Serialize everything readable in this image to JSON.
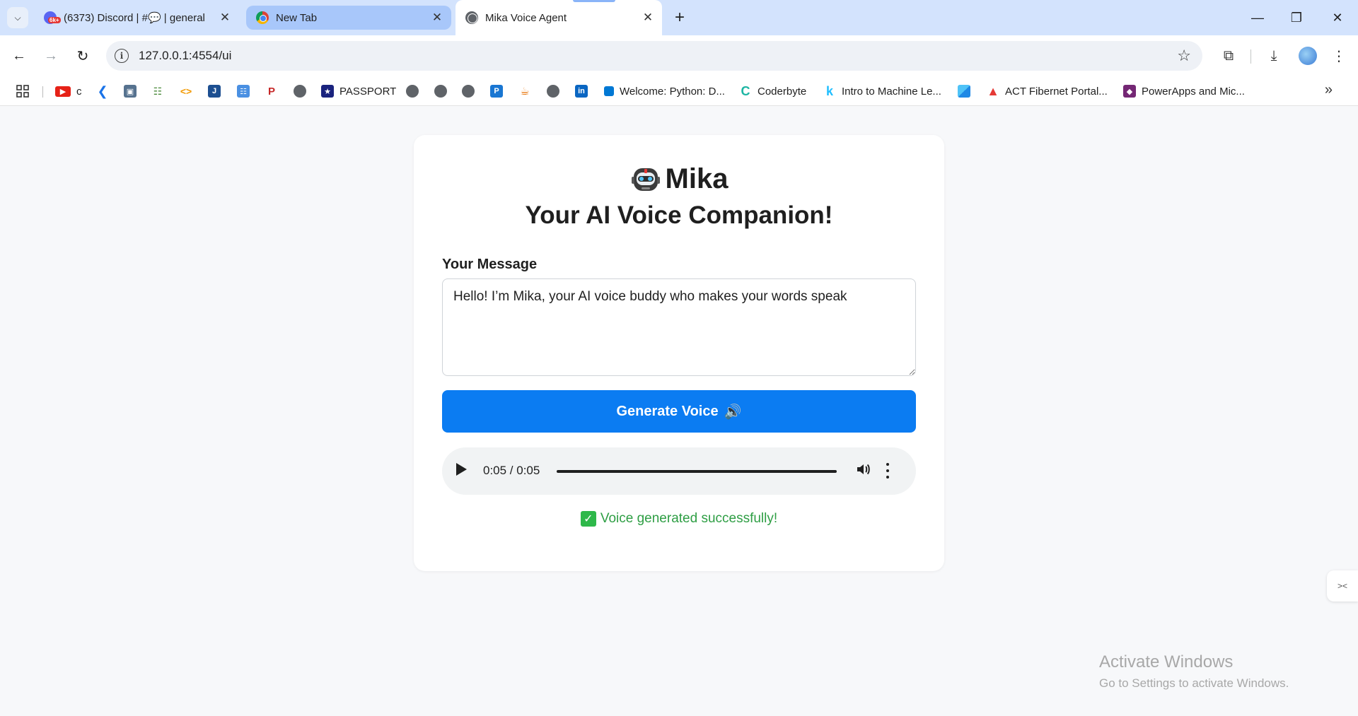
{
  "browser": {
    "tabs": [
      {
        "title": "(6373) Discord | #💬 | general",
        "favicon": "discord-icon",
        "badge": "6k+",
        "active": false
      },
      {
        "title": "New Tab",
        "favicon": "chrome-icon",
        "active": false
      },
      {
        "title": "Mika Voice Agent",
        "favicon": "globe-icon",
        "active": true
      }
    ],
    "url": "127.0.0.1:4554/ui",
    "bookmarks": [
      {
        "label": "c",
        "icon": "youtube-icon"
      },
      {
        "label": "",
        "icon": "kotak-icon"
      },
      {
        "label": "",
        "icon": "computer-icon"
      },
      {
        "label": "",
        "icon": "grid-icon"
      },
      {
        "label": "",
        "icon": "code-icon"
      },
      {
        "label": "",
        "icon": "j-icon"
      },
      {
        "label": "",
        "icon": "people-icon"
      },
      {
        "label": "",
        "icon": "graduate-icon"
      },
      {
        "label": "",
        "icon": "globe-icon"
      },
      {
        "label": "PASSPORT",
        "icon": "passport-icon"
      },
      {
        "label": "",
        "icon": "globe-icon"
      },
      {
        "label": "",
        "icon": "globe-icon"
      },
      {
        "label": "",
        "icon": "globe-icon"
      },
      {
        "label": "",
        "icon": "p-icon"
      },
      {
        "label": "",
        "icon": "java-icon"
      },
      {
        "label": "",
        "icon": "globe-icon"
      },
      {
        "label": "",
        "icon": "linkedin-icon"
      },
      {
        "label": "Welcome: Python: D...",
        "icon": "vscode-icon"
      },
      {
        "label": "Coderbyte",
        "icon": "coderbyte-icon"
      },
      {
        "label": "Intro to Machine Le...",
        "icon": "kaggle-icon"
      },
      {
        "label": "",
        "icon": "blocks-icon"
      },
      {
        "label": "ACT Fibernet Portal...",
        "icon": "act-icon"
      },
      {
        "label": "PowerApps and Mic...",
        "icon": "powerapps-icon"
      }
    ]
  },
  "app": {
    "brand_name": "Mika",
    "brand_icon": "robot-icon",
    "subtitle": "Your AI Voice Companion!",
    "message_label": "Your Message",
    "message_value": "Hello! I’m Mika, your AI voice buddy who makes your words speak",
    "generate_label": "Generate Voice",
    "generate_icon": "speaker-icon",
    "audio": {
      "time": "0:05 / 0:05",
      "progress": 1.0
    },
    "status_text": "Voice generated successfully!",
    "status_color": "#2e9e44",
    "accent_color": "#0b7cf2"
  },
  "os": {
    "activate_title": "Activate Windows",
    "activate_sub": "Go to Settings to activate Windows."
  }
}
